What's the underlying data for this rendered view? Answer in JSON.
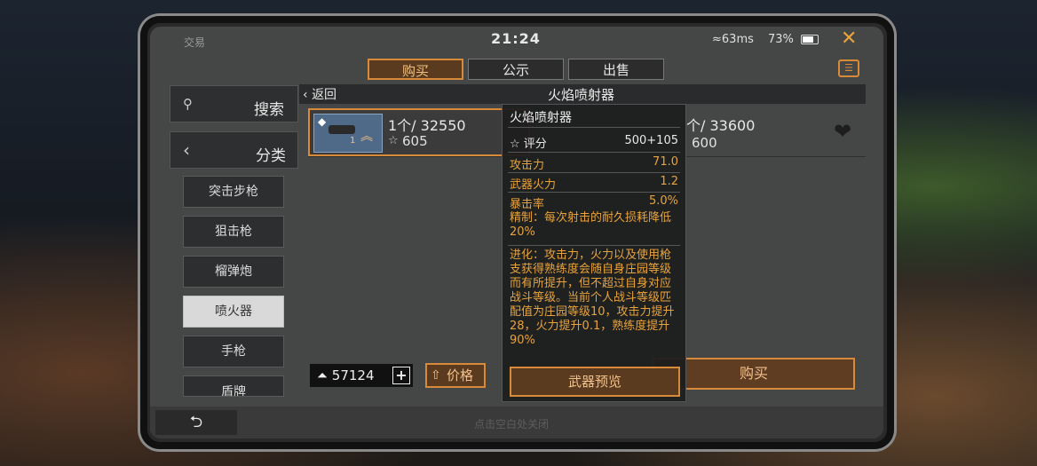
{
  "status": {
    "app": "交易",
    "time": "21:24",
    "ping": "63ms",
    "battery": "73%"
  },
  "tabs": [
    "购买",
    "公示",
    "出售"
  ],
  "left": {
    "search": "搜索",
    "category": "分类",
    "categories": [
      "突击步枪",
      "狙击枪",
      "榴弹炮",
      "喷火器",
      "手枪",
      "盾牌"
    ]
  },
  "header": {
    "back": "返回",
    "title": "火焰喷射器"
  },
  "listings": [
    {
      "qty_price": "1个/ 32550",
      "rating": "605"
    },
    {
      "qty_price": "个/ 33600",
      "rating": "600"
    }
  ],
  "tooltip": {
    "name": "火焰喷射器",
    "score_label": "评分",
    "score_value": "500+105",
    "stats": [
      {
        "label": "攻击力",
        "value": "71.0"
      },
      {
        "label": "武器火力",
        "value": "1.2"
      },
      {
        "label": "暴击率",
        "value": "5.0%"
      }
    ],
    "refine": "精制：每次射击的耐久损耗降低20%",
    "evolve": "进化：攻击力，火力以及使用枪支获得熟练度会随自身庄园等级而有所提升，但不超过自身对应战斗等级。当前个人战斗等级匹配值为庄园等级10，攻击力提升28，火力提升0.1，熟练度提升90%",
    "preview": "武器预览"
  },
  "bottom": {
    "balance": "57124",
    "sort": "价格",
    "buy": "购买",
    "hint": "点击空白处关闭",
    "thumb_level": "1"
  },
  "colors": {
    "accent": "#d88a3b",
    "stat_text": "#e8a33c"
  }
}
